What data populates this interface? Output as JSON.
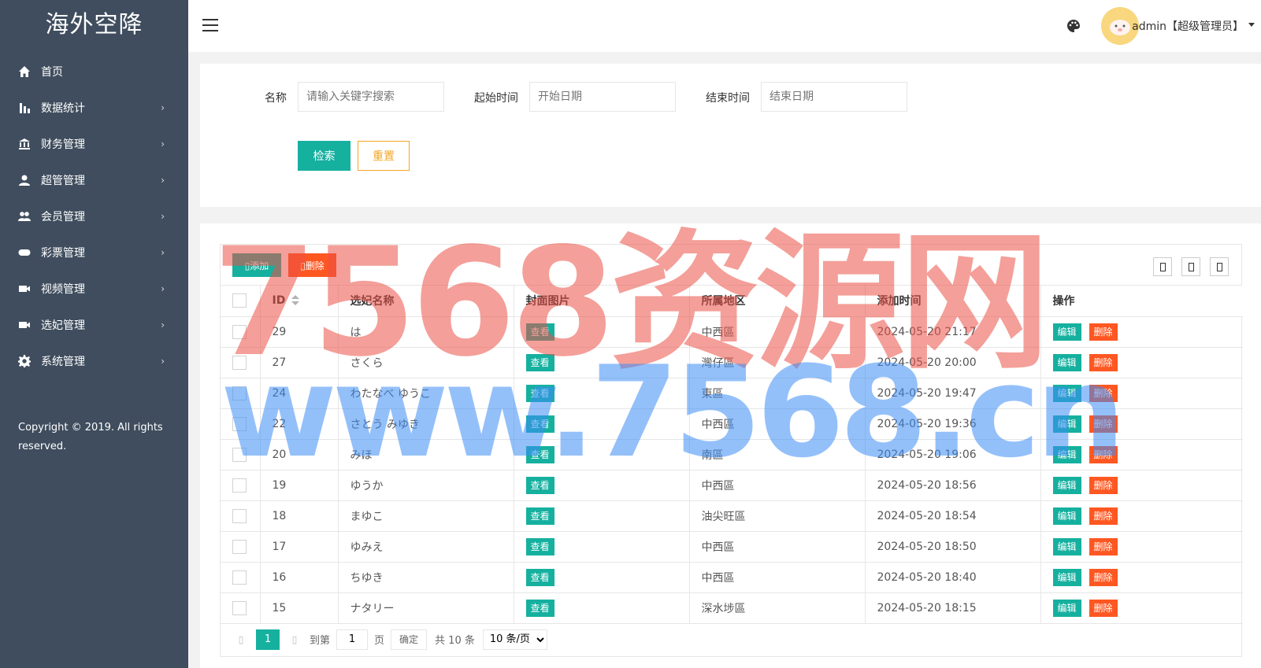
{
  "app": {
    "title": "海外空降"
  },
  "sidebar": {
    "items": [
      {
        "label": "首页",
        "icon": "home-icon",
        "has_children": false
      },
      {
        "label": "数据统计",
        "icon": "bar-chart-icon",
        "has_children": true
      },
      {
        "label": "财务管理",
        "icon": "bank-icon",
        "has_children": true
      },
      {
        "label": "超管管理",
        "icon": "user-icon",
        "has_children": true
      },
      {
        "label": "会员管理",
        "icon": "users-icon",
        "has_children": true
      },
      {
        "label": "彩票管理",
        "icon": "gamepad-icon",
        "has_children": true
      },
      {
        "label": "视频管理",
        "icon": "video-icon",
        "has_children": true
      },
      {
        "label": "选妃管理",
        "icon": "video-icon",
        "has_children": true
      },
      {
        "label": "系统管理",
        "icon": "gear-icon",
        "has_children": true
      }
    ],
    "arrow": "›",
    "copyright": "Copyright © 2019. All rights reserved."
  },
  "header": {
    "user": "admin【超级管理员】",
    "menu_icon": "hamburger-icon",
    "theme_icon": "palette-icon"
  },
  "search": {
    "name_label": "名称",
    "name_placeholder": "请输入关键字搜索",
    "start_label": "起始时间",
    "start_placeholder": "开始日期",
    "end_label": "结束时间",
    "end_placeholder": "结束日期",
    "search_button": "检索",
    "reset_button": "重置"
  },
  "toolbar": {
    "add_label": "添加",
    "delete_label": "删除"
  },
  "table": {
    "columns": [
      "ID",
      "选妃名称",
      "封面图片",
      "所属地区",
      "添加时间",
      "操作"
    ],
    "view_label": "查看",
    "edit_label": "编辑",
    "remove_label": "删除",
    "rows": [
      {
        "id": "29",
        "name": "は",
        "region": "中西區",
        "time": "2024-05-20 21:17"
      },
      {
        "id": "27",
        "name": "さくら",
        "region": "灣仔區",
        "time": "2024-05-20 20:00"
      },
      {
        "id": "24",
        "name": "わたなべ ゆうこ",
        "region": "東區",
        "time": "2024-05-20 19:47"
      },
      {
        "id": "22",
        "name": "さとう みゆき",
        "region": "中西區",
        "time": "2024-05-20 19:36"
      },
      {
        "id": "20",
        "name": "みほ",
        "region": "南區",
        "time": "2024-05-20 19:06"
      },
      {
        "id": "19",
        "name": "ゆうか",
        "region": "中西區",
        "time": "2024-05-20 18:56"
      },
      {
        "id": "18",
        "name": "まゆこ",
        "region": "油尖旺區",
        "time": "2024-05-20 18:54"
      },
      {
        "id": "17",
        "name": "ゆみえ",
        "region": "中西區",
        "time": "2024-05-20 18:50"
      },
      {
        "id": "16",
        "name": "ちゆき",
        "region": "中西區",
        "time": "2024-05-20 18:40"
      },
      {
        "id": "15",
        "name": "ナタリー",
        "region": "深水埗區",
        "time": "2024-05-20 18:15"
      }
    ]
  },
  "pagination": {
    "current": "1",
    "goto_label": "到第",
    "page_input": "1",
    "page_label": "页",
    "confirm": "确定",
    "total": "共 10 条",
    "per_page": "10 条/页"
  },
  "watermark": {
    "line1": "7568资源网",
    "line2": "www.7568.cn"
  },
  "colors": {
    "sidebar_bg": "#3f4d5e",
    "primary": "#16b09f",
    "danger": "#ff5722",
    "warning": "#f5a623"
  }
}
